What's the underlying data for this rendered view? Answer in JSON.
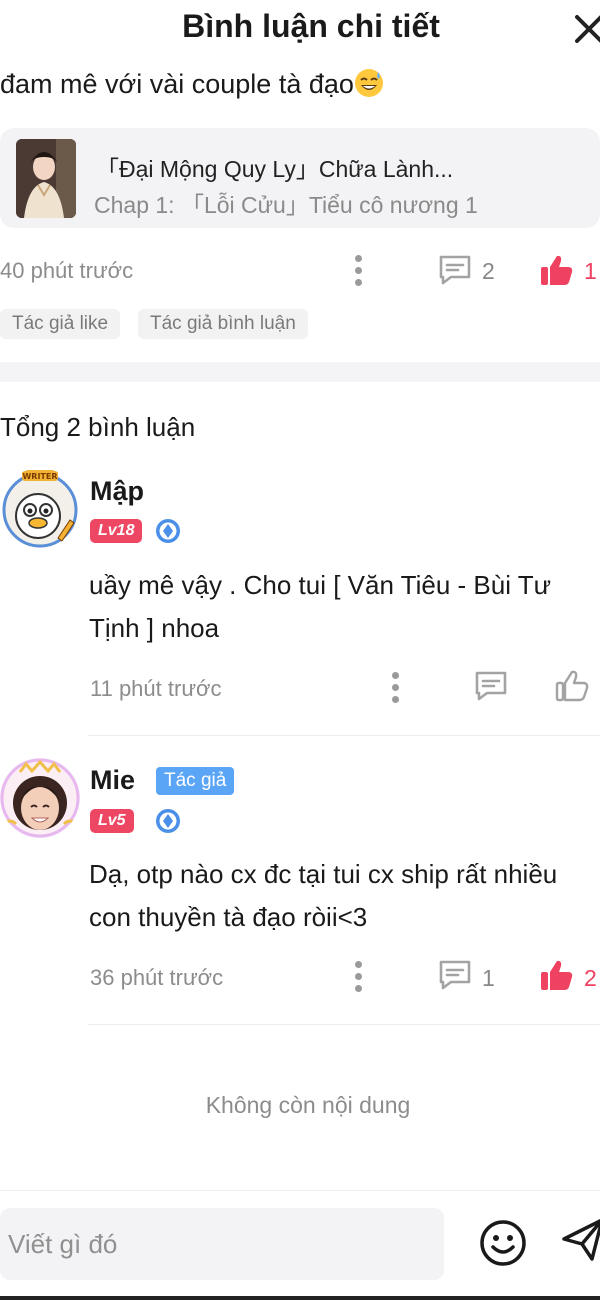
{
  "header": {
    "title": "Bình luận chi tiết"
  },
  "post": {
    "text_tail": "đam mê với vài couple tà đạo",
    "emoji": "grinning-sweat-emoji",
    "story_title": "「Đại Mộng Quy Ly」Chữa Lành...",
    "story_chapter": "Chap 1: 「Lỗi Cửu」Tiểu cô nương 1",
    "time": "40 phút trước",
    "comment_count": "2",
    "like_count": "1",
    "tags": [
      "Tác giả like",
      "Tác giả bình luận"
    ]
  },
  "comments_header": {
    "total": "Tổng 2 bình luận"
  },
  "comments": [
    {
      "username": "Mập",
      "level": "Lv18",
      "text": "uầy mê vậy . Cho tui [ Văn Tiêu - Bùi Tư Tịnh ] nhoa",
      "time": "11 phút trước",
      "liked": false
    },
    {
      "username": "Mie",
      "author_tag": "Tác giả",
      "level": "Lv5",
      "text": "Dạ, otp nào cx đc tại tui cx ship rất nhiều con thuyền tà đạo ròii<3",
      "time": "36 phút trước",
      "reply_count": "1",
      "like_count": "2",
      "liked": true
    }
  ],
  "footer": {
    "end_text": "Không còn nội dung"
  },
  "input": {
    "placeholder": "Viết gì đó"
  },
  "colors": {
    "accent": "#ef4160",
    "author_blue": "#5aa5f5",
    "level_red": "#ee4764"
  }
}
